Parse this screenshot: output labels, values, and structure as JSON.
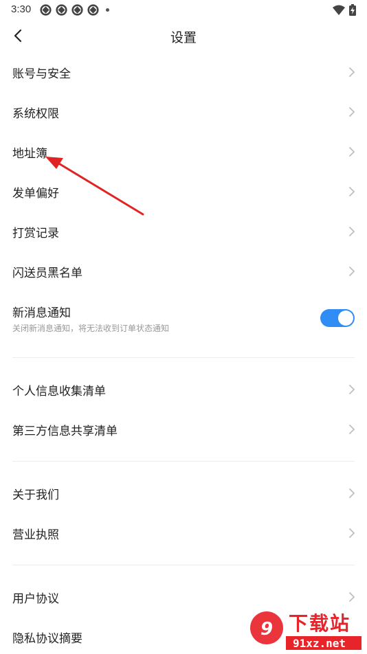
{
  "status_bar": {
    "time": "3:30"
  },
  "header": {
    "title": "设置"
  },
  "groups": {
    "account": [
      {
        "label": "账号与安全"
      },
      {
        "label": "系统权限"
      },
      {
        "label": "地址簿"
      },
      {
        "label": "发单偏好"
      },
      {
        "label": "打赏记录"
      },
      {
        "label": "闪送员黑名单"
      }
    ],
    "notification": {
      "label": "新消息通知",
      "subtitle": "关闭新消息通知，将无法收到订单状态通知",
      "enabled": true
    },
    "privacy": [
      {
        "label": "个人信息收集清单"
      },
      {
        "label": "第三方信息共享清单"
      }
    ],
    "about": [
      {
        "label": "关于我们"
      },
      {
        "label": "营业执照"
      }
    ],
    "legal": [
      {
        "label": "用户协议"
      },
      {
        "label": "隐私协议摘要"
      }
    ]
  },
  "watermark": {
    "brand": "下载站",
    "domain": "91xz.net"
  },
  "colors": {
    "toggle_on": "#2f8df5",
    "annotation_arrow": "#e02424",
    "watermark_red": "#e8242b",
    "chevron": "#bfbfbf"
  }
}
